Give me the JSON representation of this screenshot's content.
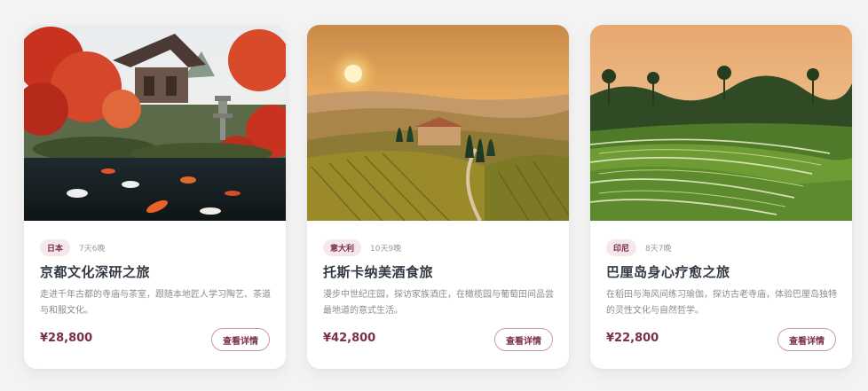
{
  "cards": [
    {
      "country": "日本",
      "duration": "7天6晚",
      "title": "京都文化深研之旅",
      "description": "走进千年古都的寺庙与茶室，跟随本地匠人学习陶艺、茶道与和服文化。",
      "price": "¥28,800",
      "button_label": "查看详情",
      "image_alt": "京都寺庙红枫与锦鲤池"
    },
    {
      "country": "意大利",
      "duration": "10天9晚",
      "title": "托斯卡纳美酒食旅",
      "description": "漫步中世纪庄园，探访家族酒庄，在橄榄园与葡萄田间品尝最地道的意式生活。",
      "price": "¥42,800",
      "button_label": "查看详情",
      "image_alt": "托斯卡纳日落葡萄园与庄园"
    },
    {
      "country": "印尼",
      "duration": "8天7晚",
      "title": "巴厘岛身心疗愈之旅",
      "description": "在稻田与海风间练习瑜伽，探访古老寺庙，体验巴厘岛独特的灵性文化与自然哲学。",
      "price": "¥22,800",
      "button_label": "查看详情",
      "image_alt": "巴厘岛梯田与椰林"
    }
  ],
  "colors": {
    "accent": "#7a2f47",
    "badge_bg": "#f6e7ea",
    "page_bg": "#f4f3f3"
  }
}
